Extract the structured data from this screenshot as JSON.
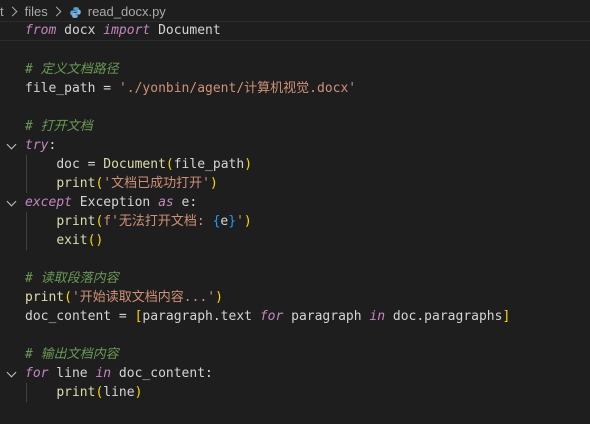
{
  "breadcrumb": {
    "root": "t",
    "folder": "files",
    "file": "read_docx.py"
  },
  "colors": {
    "background": "#1e1e1e",
    "keyword": "#c586c0",
    "comment": "#6a9955",
    "string": "#ce9178",
    "function": "#dcdcaa",
    "bracket_level1": "#ffd700",
    "bracket_level2": "#da70d6",
    "bracket_level3": "#179fff"
  },
  "code": {
    "l1": {
      "kw_from": "from",
      "module": " docx ",
      "kw_import": "import",
      "name": " Document"
    },
    "l3": {
      "comment": "# 定义文档路径"
    },
    "l4": {
      "var": "file_path",
      "eq": " = ",
      "str": "'./yonbin/agent/计算机视觉.docx'"
    },
    "l6": {
      "comment": "# 打开文档"
    },
    "l7": {
      "kw": "try",
      "colon": ":"
    },
    "l8": {
      "indent": "    ",
      "var": "doc",
      "eq": " = ",
      "fn": "Document",
      "open": "(",
      "arg": "file_path",
      "close": ")"
    },
    "l9": {
      "indent": "    ",
      "fn": "print",
      "open": "(",
      "str": "'文档已成功打开'",
      "close": ")"
    },
    "l10": {
      "kw_except": "except",
      "exc": " Exception ",
      "kw_as": "as",
      "rest": " e:"
    },
    "l11": {
      "indent": "    ",
      "fn": "print",
      "open": "(",
      "fprefix": "f",
      "str1": "'无法打开文档: ",
      "brace_open": "{",
      "var": "e",
      "brace_close": "}",
      "str2": "'",
      "close": ")"
    },
    "l12": {
      "indent": "    ",
      "fn": "exit",
      "parens": "()"
    },
    "l14": {
      "comment": "# 读取段落内容"
    },
    "l15": {
      "fn": "print",
      "open": "(",
      "str": "'开始读取文档内容...'",
      "close": ")"
    },
    "l16": {
      "var": "doc_content",
      "eq": " = ",
      "open": "[",
      "expr": "paragraph.text ",
      "kw_for": "for",
      "mid": " paragraph ",
      "kw_in": "in",
      "tail": " doc.paragraphs",
      "close": "]"
    },
    "l18": {
      "comment": "# 输出文档内容"
    },
    "l19": {
      "kw_for": "for",
      "var": " line ",
      "kw_in": "in",
      "rest": " doc_content:"
    },
    "l20": {
      "indent": "    ",
      "fn": "print",
      "open": "(",
      "arg": "line",
      "close": ")"
    }
  }
}
